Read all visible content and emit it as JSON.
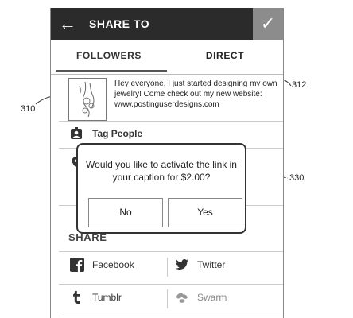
{
  "header": {
    "title": "SHARE TO",
    "back_icon": "arrow-left-icon",
    "confirm_icon": "checkmark-icon"
  },
  "tabs": [
    {
      "label": "FOLLOWERS",
      "selected": true
    },
    {
      "label": "DIRECT",
      "selected": false
    }
  ],
  "caption": {
    "text": "Hey everyone, I just started designing my own jewelry!  Come check out my new website: www.postinguserdesigns.com"
  },
  "menu": [
    {
      "label": "Tag People",
      "icon": "person-tag-icon"
    },
    {
      "label": "",
      "icon": "location-pin-icon"
    }
  ],
  "dialog": {
    "message": "Would you like to activate the link in your caption for $2.00?",
    "no_label": "No",
    "yes_label": "Yes"
  },
  "share": {
    "header": "SHARE",
    "items": [
      {
        "label": "Facebook",
        "icon": "facebook-icon"
      },
      {
        "label": "Twitter",
        "icon": "twitter-icon"
      },
      {
        "label": "Tumblr",
        "icon": "tumblr-icon"
      },
      {
        "label": "Swarm",
        "icon": "swarm-icon"
      }
    ]
  },
  "callouts": {
    "caption_ref": "312",
    "thumb_ref": "310",
    "dialog_ref": "330"
  }
}
